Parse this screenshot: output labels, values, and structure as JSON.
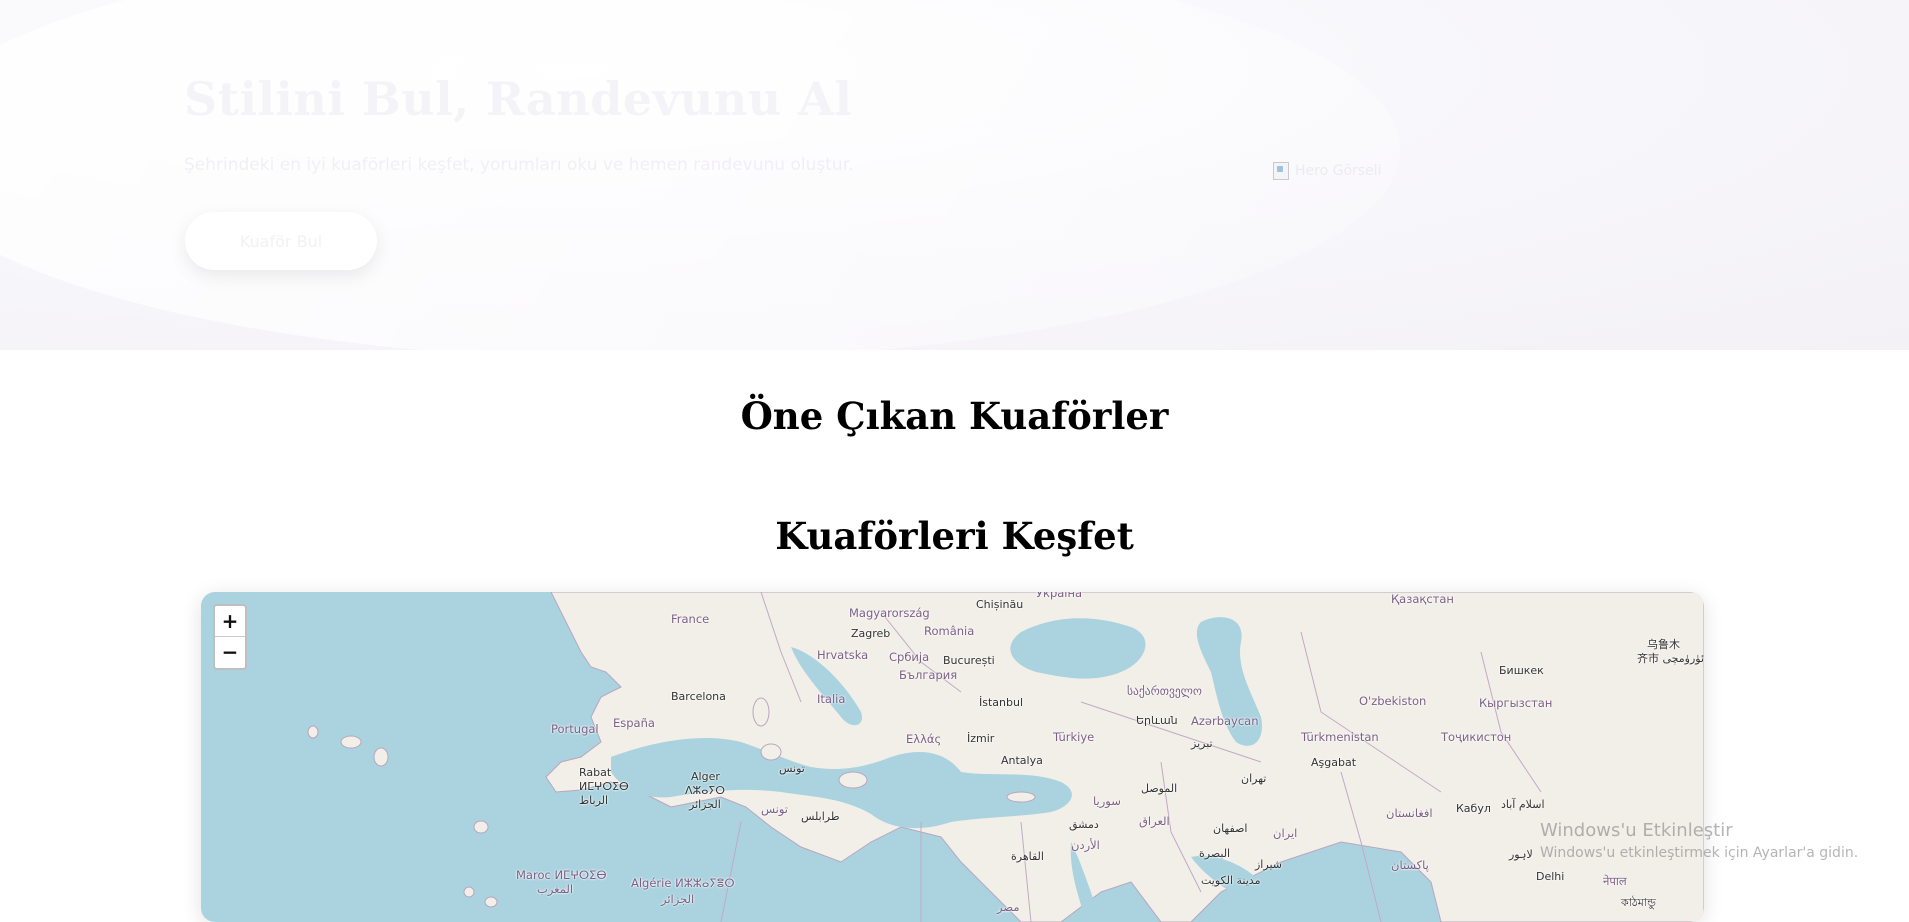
{
  "hero": {
    "title": "Stilini Bul, Randevunu Al",
    "subtitle": "Şehrindeki en iyi kuaförleri keşfet, yorumları oku ve hemen randevunu oluştur.",
    "cta_label": "Kuaför Bul",
    "image_alt": "Hero Görseli"
  },
  "sections": {
    "featured_title": "Öne Çıkan Kuaförler",
    "explore_title": "Kuaförleri Keşfet"
  },
  "map": {
    "zoom_in": "+",
    "zoom_out": "−",
    "labels": [
      {
        "text": "Україна"
      },
      {
        "text": "Қазақстан"
      },
      {
        "text": "Chișinău"
      },
      {
        "text": "Magyarország"
      },
      {
        "text": "France"
      },
      {
        "text": "Zagreb"
      },
      {
        "text": "România"
      },
      {
        "text": "Hrvatska"
      },
      {
        "text": "Србија"
      },
      {
        "text": "București"
      },
      {
        "text": "България"
      },
      {
        "text": "乌鲁木"
      },
      {
        "text": "齐市 ئۈرۈمچى"
      },
      {
        "text": "Бишкек"
      },
      {
        "text": "Barcelona"
      },
      {
        "text": "Italia"
      },
      {
        "text": "İstanbul"
      },
      {
        "text": "საქართველო"
      },
      {
        "text": "O'zbekiston"
      },
      {
        "text": "Кыргызстан"
      },
      {
        "text": "Portugal"
      },
      {
        "text": "España"
      },
      {
        "text": "Երևան"
      },
      {
        "text": "Azərbaycan"
      },
      {
        "text": "Ελλάς"
      },
      {
        "text": "İzmir"
      },
      {
        "text": "Türkiye"
      },
      {
        "text": "Türkmenistan"
      },
      {
        "text": "Тоҷикистон"
      },
      {
        "text": "تبریز"
      },
      {
        "text": "Antalya"
      },
      {
        "text": "Aşgabat"
      },
      {
        "text": "Rabat"
      },
      {
        "text": "Alger"
      },
      {
        "text": "تونس"
      },
      {
        "text": "ⵍⵎⵖⵔⵉⴱ"
      },
      {
        "text": "ⴷⵣⴰⵢⵔ"
      },
      {
        "text": "تهران"
      },
      {
        "text": "الرباط"
      },
      {
        "text": "الجزائر"
      },
      {
        "text": "الموصل"
      },
      {
        "text": "سوريا"
      },
      {
        "text": "تونس"
      },
      {
        "text": "طرابلس"
      },
      {
        "text": "Кабул"
      },
      {
        "text": "اسلام آباد"
      },
      {
        "text": "افغانستان"
      },
      {
        "text": "دمشق"
      },
      {
        "text": "العراق"
      },
      {
        "text": "اصفهان"
      },
      {
        "text": "ایران"
      },
      {
        "text": "الأردن"
      },
      {
        "text": "القاهرة"
      },
      {
        "text": "البصرة"
      },
      {
        "text": "لاہور"
      },
      {
        "text": "Delhi"
      },
      {
        "text": "شیراز"
      },
      {
        "text": "مدينة الكويت"
      },
      {
        "text": "پاکستان"
      },
      {
        "text": "Maroc ⵍⵎⵖⵔⵉⴱ"
      },
      {
        "text": "المغرب"
      },
      {
        "text": "Algérie ⵍⵣⵣⴰⵢⴻⵔ"
      },
      {
        "text": "الجزائر"
      },
      {
        "text": "مصر"
      },
      {
        "text": "नेपाल"
      },
      {
        "text": "কাঠমান্ডু"
      }
    ]
  },
  "watermark": {
    "line1": "Windows'u Etkinleştir",
    "line2": "Windows'u etkinleştirmek için Ayarlar'a gidin."
  }
}
